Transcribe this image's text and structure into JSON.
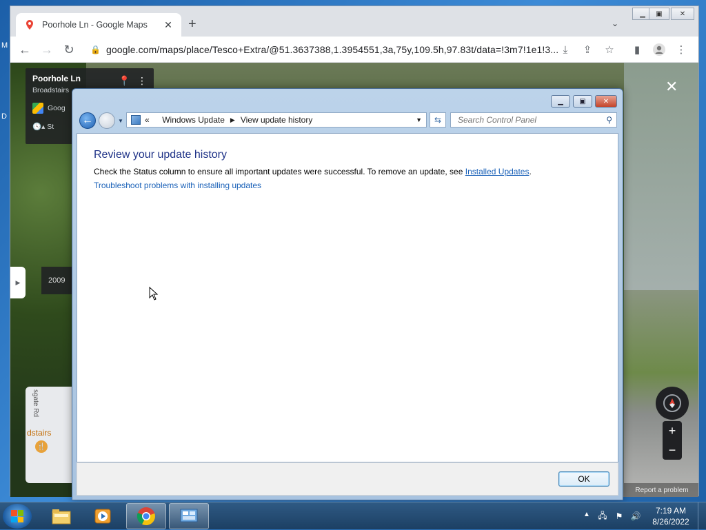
{
  "desktop": {
    "letter_m": "M",
    "letter_d": "D"
  },
  "browser": {
    "tab_title": "Poorhole Ln - Google Maps",
    "tab_close": "✕",
    "new_tab": "+",
    "url": "google.com/maps/place/Tesco+Extra/@51.3637388,1.3954551,3a,75y,109.5h,97.83t/data=!3m7!1e1!3..."
  },
  "streetview": {
    "title": "Poorhole Ln",
    "subtitle": "Broadstairs",
    "google_label": "Goog",
    "history_label": "St",
    "year": "2009",
    "minimap_road": "sgate Rd",
    "minimap_town": "dstairs",
    "report": "Report a problem",
    "zoom_in": "+",
    "zoom_out": "−",
    "close": "✕"
  },
  "dialog": {
    "breadcrumb_prefix": "«",
    "crumb1": "Windows Update",
    "crumb2": "View update history",
    "search_placeholder": "Search Control Panel",
    "heading": "Review your update history",
    "desc_text": "Check the Status column to ensure all important updates were successful. To remove an update, see ",
    "installed_link": "Installed Updates",
    "desc_end": ".",
    "troubleshoot_link": "Troubleshoot problems with installing updates",
    "ok": "OK"
  },
  "taskbar": {
    "time": "7:19 AM",
    "date": "8/26/2022"
  },
  "colors": {
    "link": "#1a61b8",
    "heading": "#1e3287",
    "taskbar": "#1c3f63"
  }
}
